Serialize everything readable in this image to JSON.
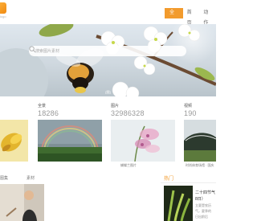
{
  "header": {
    "logo_text": "logo",
    "nav": [
      "全景",
      "首页",
      "动作"
    ]
  },
  "hero": {
    "search_placeholder": "搜索图片素材",
    "caption": "[图]"
  },
  "stats": [
    {
      "label": "",
      "value": ""
    },
    {
      "label": "全景",
      "value": "18286"
    },
    {
      "label": "图片",
      "value": "32986328"
    },
    {
      "label": "视频",
      "value": "190"
    }
  ],
  "cards": [
    {
      "caption": ""
    },
    {
      "caption": ""
    },
    {
      "caption": "蝴蝶兰图片"
    },
    {
      "caption": "时尚体育场馆 · 国庆"
    }
  ],
  "tabs": [
    "图集",
    "素材"
  ],
  "news": {
    "title": "热门",
    "headline": "二十四节气",
    "date": "8日）",
    "lines": [
      "立夏是农历",
      "气，夏季的",
      "日出前后"
    ]
  },
  "colors": {
    "accent": "#f29b2d"
  }
}
